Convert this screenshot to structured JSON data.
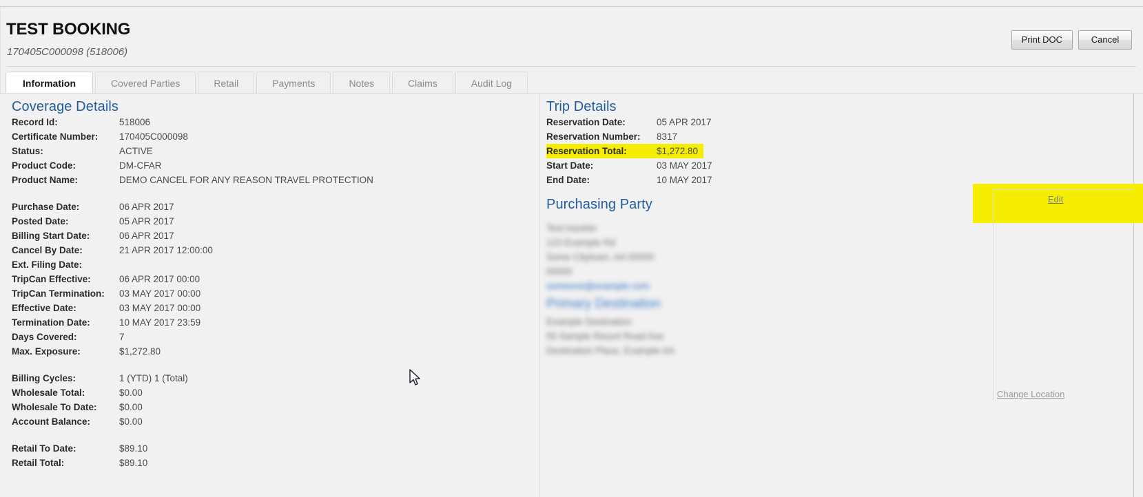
{
  "header": {
    "title": "TEST BOOKING",
    "subtitle": "170405C000098 (518006)",
    "buttons": {
      "print": "Print DOC",
      "cancel": "Cancel"
    }
  },
  "tabs": [
    {
      "label": "Information",
      "active": true
    },
    {
      "label": "Covered Parties",
      "active": false
    },
    {
      "label": "Retail",
      "active": false
    },
    {
      "label": "Payments",
      "active": false
    },
    {
      "label": "Notes",
      "active": false
    },
    {
      "label": "Claims",
      "active": false
    },
    {
      "label": "Audit Log",
      "active": false
    }
  ],
  "coverage_details": {
    "title": "Coverage Details",
    "fields": [
      {
        "label": "Record Id:",
        "value": "518006"
      },
      {
        "label": "Certificate Number:",
        "value": "170405C000098"
      },
      {
        "label": "Status:",
        "value": "ACTIVE"
      },
      {
        "label": "Product Code:",
        "value": "DM-CFAR"
      },
      {
        "label": "Product Name:",
        "value": "DEMO CANCEL FOR ANY REASON TRAVEL PROTECTION"
      },
      {
        "label": "",
        "value": "",
        "spacer": true
      },
      {
        "label": "Purchase Date:",
        "value": "06 APR 2017"
      },
      {
        "label": "Posted Date:",
        "value": "05 APR 2017"
      },
      {
        "label": "Billing Start Date:",
        "value": "06 APR 2017"
      },
      {
        "label": "Cancel By Date:",
        "value": "21 APR 2017 12:00:00"
      },
      {
        "label": "Ext. Filing Date:",
        "value": ""
      },
      {
        "label": "TripCan Effective:",
        "value": "06 APR 2017 00:00"
      },
      {
        "label": "TripCan Termination:",
        "value": "03 MAY 2017 00:00"
      },
      {
        "label": "Effective Date:",
        "value": "03 MAY 2017 00:00"
      },
      {
        "label": "Termination Date:",
        "value": "10 MAY 2017 23:59"
      },
      {
        "label": "Days Covered:",
        "value": "7"
      },
      {
        "label": "Max. Exposure:",
        "value": "$1,272.80"
      },
      {
        "label": "",
        "value": "",
        "spacer": true
      },
      {
        "label": "Billing Cycles:",
        "value": "1 (YTD) 1 (Total)"
      },
      {
        "label": "Wholesale Total:",
        "value": "$0.00"
      },
      {
        "label": "Wholesale To Date:",
        "value": "$0.00"
      },
      {
        "label": "Account Balance:",
        "value": "$0.00"
      },
      {
        "label": "",
        "value": "",
        "spacer": true
      },
      {
        "label": "Retail To Date:",
        "value": "$89.10"
      },
      {
        "label": "Retail Total:",
        "value": "$89.10"
      }
    ]
  },
  "trip_details": {
    "title": "Trip Details",
    "fields": [
      {
        "label": "Reservation Date:",
        "value": "05 APR 2017",
        "highlighted": false
      },
      {
        "label": "Reservation Number:",
        "value": "8317",
        "highlighted": false
      },
      {
        "label": "Reservation Total:",
        "value": "$1,272.80",
        "highlighted": true
      },
      {
        "label": "Start Date:",
        "value": "03 MAY 2017",
        "highlighted": false
      },
      {
        "label": "End Date:",
        "value": "10 MAY 2017",
        "highlighted": false
      }
    ]
  },
  "purchasing_party": {
    "title": "Purchasing Party",
    "redacted_lines": [
      "Test traveler",
      "123 Example Rd",
      "Some Citytown, AA 00000",
      "00000",
      "someone@example.com"
    ],
    "destination_heading": "Primary Destination",
    "destination_redacted_lines": [
      "Example Destination",
      "55 Sample Resort Road Ave",
      "Destination Place, Example AA"
    ]
  },
  "rail": {
    "edit_link": "Edit",
    "change_location_link": "Change Location"
  },
  "colors": {
    "highlight": "#f5ee00",
    "section_heading": "#1f5b9e",
    "page_background": "#f1f1f1",
    "active_tab_background": "#ffffff"
  }
}
